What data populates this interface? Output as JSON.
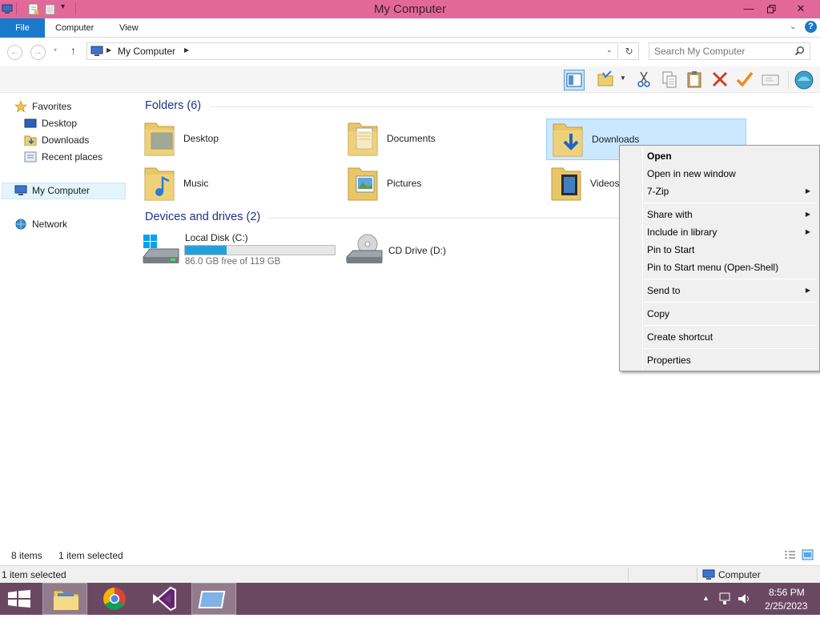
{
  "window": {
    "title": "My Computer"
  },
  "ribbon": {
    "tabs": [
      "File",
      "Computer",
      "View"
    ]
  },
  "address": {
    "path": "My Computer",
    "search_placeholder": "Search My Computer"
  },
  "nav": {
    "favorites": "Favorites",
    "items": [
      "Desktop",
      "Downloads",
      "Recent places"
    ],
    "my_computer": "My Computer",
    "network": "Network"
  },
  "folders": {
    "header": "Folders (6)",
    "items": [
      "Desktop",
      "Documents",
      "Downloads",
      "Music",
      "Pictures",
      "Videos"
    ],
    "selected": "Downloads"
  },
  "drives": {
    "header": "Devices and drives (2)",
    "items": [
      {
        "name": "Local Disk (C:)",
        "free_text": "86.0 GB free of 119 GB",
        "used_fraction": 0.28
      },
      {
        "name": "CD Drive (D:)"
      }
    ]
  },
  "context_menu": {
    "items": [
      {
        "label": "Open",
        "bold": true
      },
      {
        "label": "Open in new window"
      },
      {
        "label": "7-Zip",
        "submenu": true
      },
      {
        "label": "Share with",
        "submenu": true
      },
      {
        "label": "Include in library",
        "submenu": true
      },
      {
        "label": "Pin to Start"
      },
      {
        "label": "Pin to Start menu (Open-Shell)"
      },
      {
        "label": "Send to",
        "submenu": true
      },
      {
        "label": "Copy"
      },
      {
        "label": "Create shortcut"
      },
      {
        "label": "Properties"
      }
    ]
  },
  "status": {
    "count": "8 items",
    "selection": "1 item selected",
    "bottom_left": "1 item selected",
    "bottom_right": "Computer"
  },
  "taskbar": {
    "time": "8:56 PM",
    "date": "2/25/2023"
  },
  "colors": {
    "titlebar": "#e3689a",
    "file_tab": "#1979ca",
    "taskbar": "#6a4862",
    "selection": "#cce8ff",
    "drive_bar": "#26a0da"
  }
}
